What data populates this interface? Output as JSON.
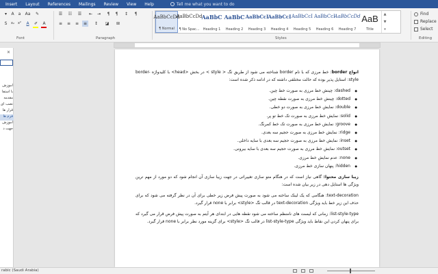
{
  "ribbon_tabs": [
    "Insert",
    "Layout",
    "References",
    "Mailings",
    "Review",
    "View",
    "Help"
  ],
  "tell_me": "Tell me what you want to do",
  "groups": {
    "font": "Font",
    "paragraph": "Paragraph",
    "styles": "Styles",
    "editing": "Editing"
  },
  "styles": [
    {
      "preview": "AaBbCcDd",
      "name": "¶ Normal"
    },
    {
      "preview": "AaBbCcDd",
      "name": "¶ No Spac..."
    },
    {
      "preview": "AaBbC",
      "name": "Heading 1"
    },
    {
      "preview": "AaBbC",
      "name": "Heading 2"
    },
    {
      "preview": "AaBbCcI",
      "name": "Heading 3"
    },
    {
      "preview": "AaBbCcI",
      "name": "Heading 4"
    },
    {
      "preview": "AaBbCcI",
      "name": "Heading 5"
    },
    {
      "preview": "AaBbCcI",
      "name": "Heading 6"
    },
    {
      "preview": "AaBbCcDd",
      "name": "Heading 7"
    },
    {
      "preview": "AaB",
      "name": "Title"
    }
  ],
  "editing": {
    "find": "Find",
    "replace": "Replace",
    "select": "Select"
  },
  "nav_items": [
    "آموزش",
    "با استفا",
    "مقدمه",
    "نصب ای",
    "قرار ها",
    "فرم ها",
    "آموزش",
    "جهت د"
  ],
  "document": {
    "p1_title": "انواع border",
    "p1_text": ": خط مرزی که با نام border شناخته می شود از طریق تگ < style > در بخش <head> با کلیدواژه  border-style: استایل پذیر بوده که حالت مختلفی داشته که در ادامه ذکر شده است:",
    "list": [
      "dashed: چینش خط مرزی به صورت خط چین.",
      "dotted: چینش خط مرزی به صورت نقطه چین.",
      "double: نمایش خط مرزی به صورت دو خطی.",
      "solid: نمایش خط مرزی به صورت تک خط تو پر.",
      "groove: نمایش خط مرزی به صورت تک خط کمرنگ.",
      "ridge: نمایش خط مرزی به صورت حجیم سه بعدی.",
      "inset: نمایش خط مرزی به صورت حجیم سه بعدی با سایه داخلی.",
      "outset: نمایش خط مرزی به صورت حجیم سه بعدی با سایه بیرونی.",
      "none: عدم نمایش خط مرزی.",
      "hidden: پنهان سازی خط مرزی."
    ],
    "p2_title": "زیبا سازی محتوا:",
    "p2_text": " گاهی نیاز است که در هنگام متو سازی تغییراتی در جهت زیبا سازی آن انجام شود که دو مورد از مهم ترین ویژگی ها استایل دهی در زیر بیان شده است:",
    "p3": "text-decoration: هنگامی که یک لینک ساخته می شود به صورت پیش فرض زیر خطی برای آن در نظر گرفته می شود که برای حذف این زیر خط باید ویژگی text-decoration در قالب تگ <style> برابر با none قرار گیرد.",
    "p4": "list-style-type: زمانی که لیست های نامنظم ساخته می شود نقطه هایی در ابتدای هر آیتم به صورت پیش فرض قرار می گیرد که برای پنهان کردن این نقاط باید ویژگی list-style-type در قالب تگ <style> برای گزینه مورد نظر برابر با none قرار گیرد."
  },
  "status": {
    "language": "rabic (Saudi Arabia)"
  }
}
